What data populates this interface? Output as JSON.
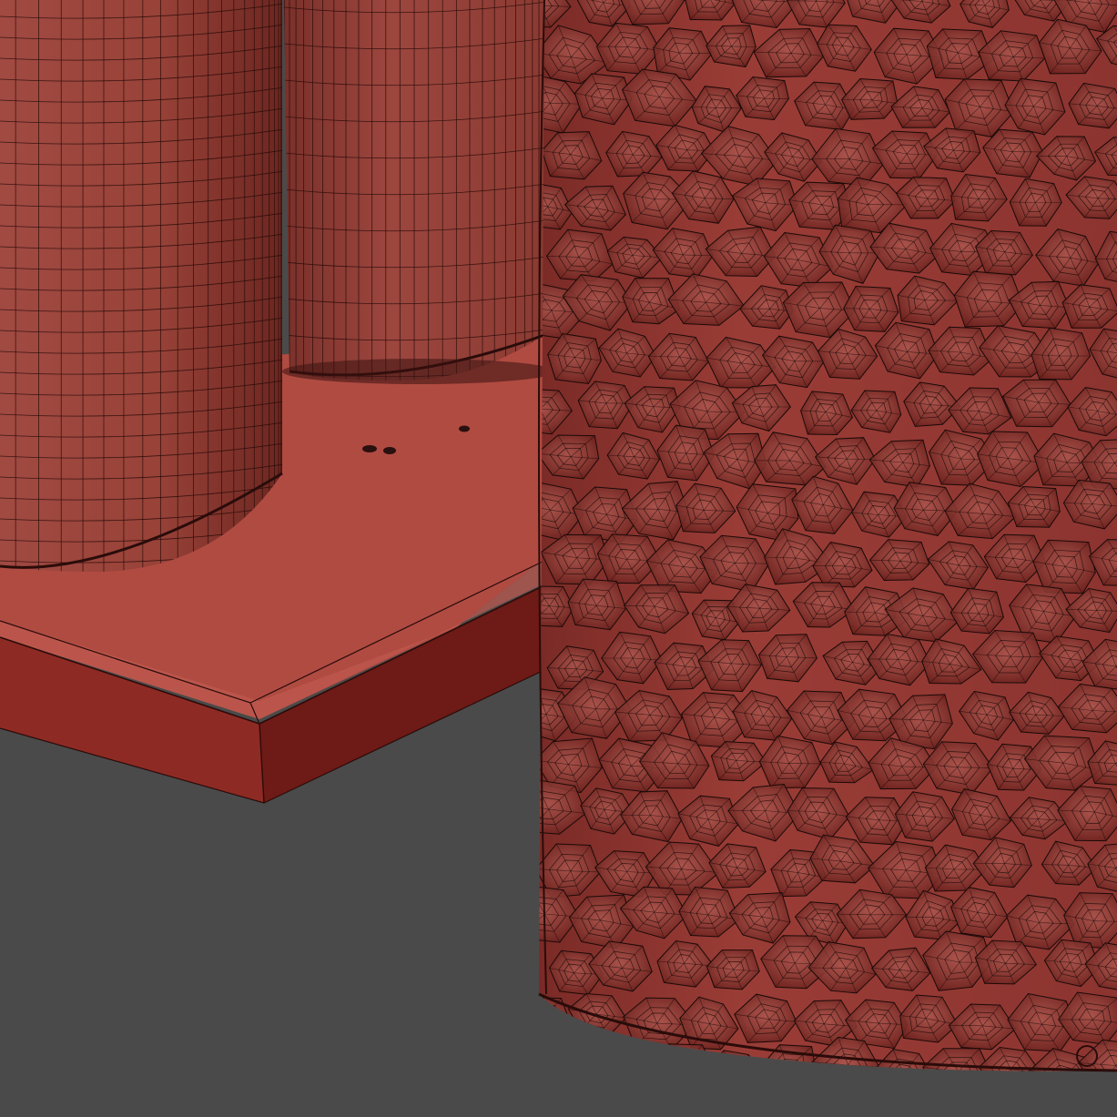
{
  "scene": {
    "render_mode": "wireframe-on-shaded",
    "objects": [
      "tall-smooth-cylinder-left",
      "short-smooth-cylinder-back",
      "beveled-base-plate",
      "faceted-textured-cylinder-right"
    ],
    "small_holes_on_plate": 3
  },
  "colors": {
    "background": "#4a4a4a",
    "plate_top": "#b04b42",
    "plate_side": "#8e2a24",
    "plate_side_dark": "#6e1a16",
    "cylinder_light": "#a84a42",
    "cylinder_dark": "#6a2420",
    "textured_base": "#8e3430",
    "wire": "#1a0a08"
  }
}
